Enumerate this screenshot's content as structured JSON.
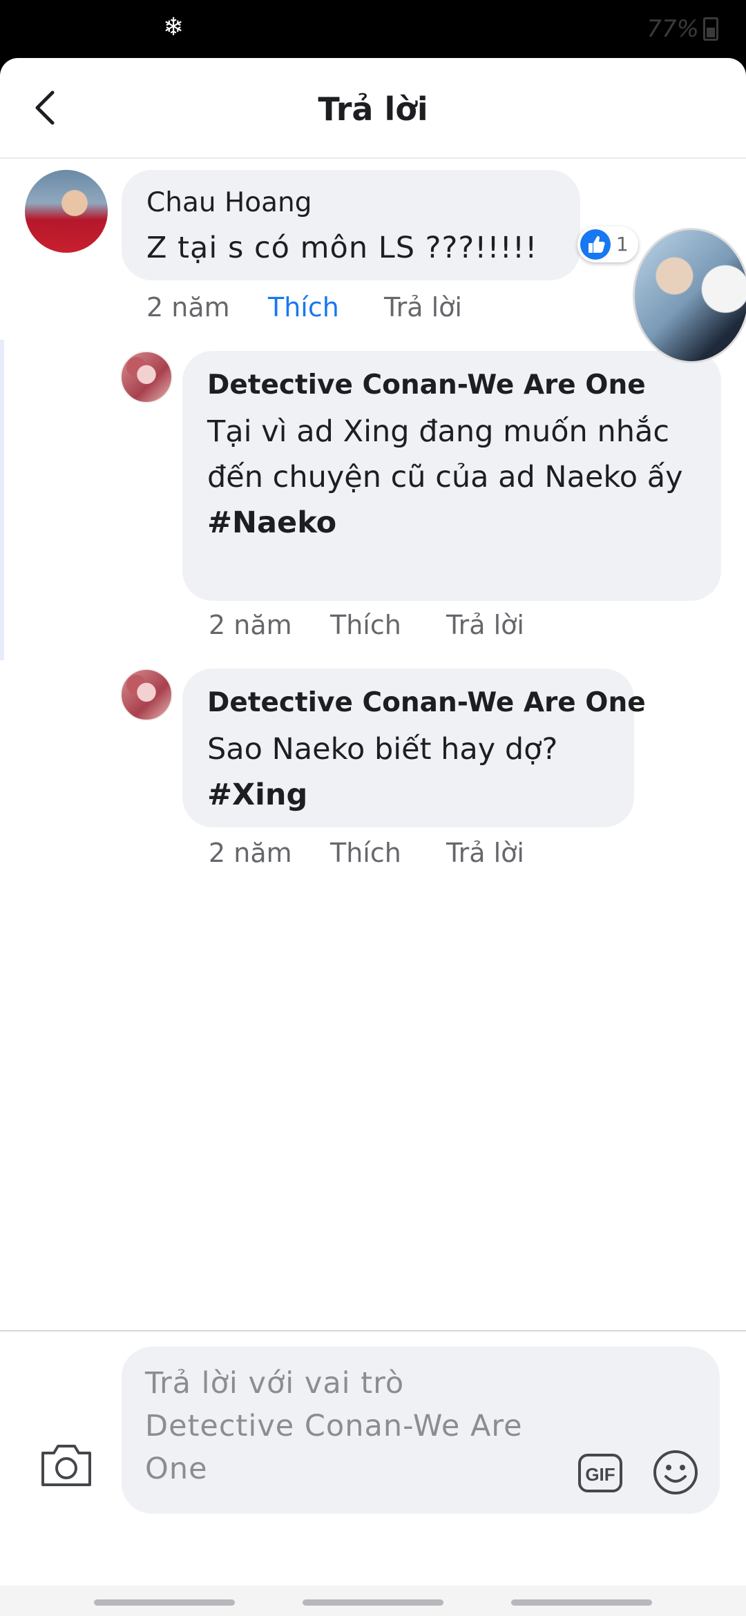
{
  "status_bar": {
    "battery": "77%",
    "notification_icon": "snowflake-icon"
  },
  "header": {
    "title": "Trả lời",
    "back_icon": "chevron-left-icon"
  },
  "parent_comment": {
    "author": "Chau Hoang",
    "text": "Z tại s có môn LS ???!!!!!",
    "time": "2 năm",
    "like_label": "Thích",
    "reply_label": "Trả lời",
    "reaction_count": "1",
    "like_state_color": "#1877f2"
  },
  "replies": [
    {
      "author": "Detective Conan-We Are One",
      "text": "Tại vì ad Xing đang muốn nhắc đến chuyện cũ của ad Naeko ấy",
      "hashtag": "#Naeko",
      "time": "2 năm",
      "like_label": "Thích",
      "reply_label": "Trả lời"
    },
    {
      "author": "Detective Conan-We Are One",
      "text": "Sao Naeko biết hay dợ?",
      "hashtag": "#Xing",
      "time": "2 năm",
      "like_label": "Thích",
      "reply_label": "Trả lời"
    }
  ],
  "composer": {
    "placeholder": "Trả lời với vai trò Detective Conan-We Are One",
    "gif_label": "GIF",
    "icons": [
      "camera-icon",
      "gif-icon",
      "emoji-icon"
    ]
  }
}
